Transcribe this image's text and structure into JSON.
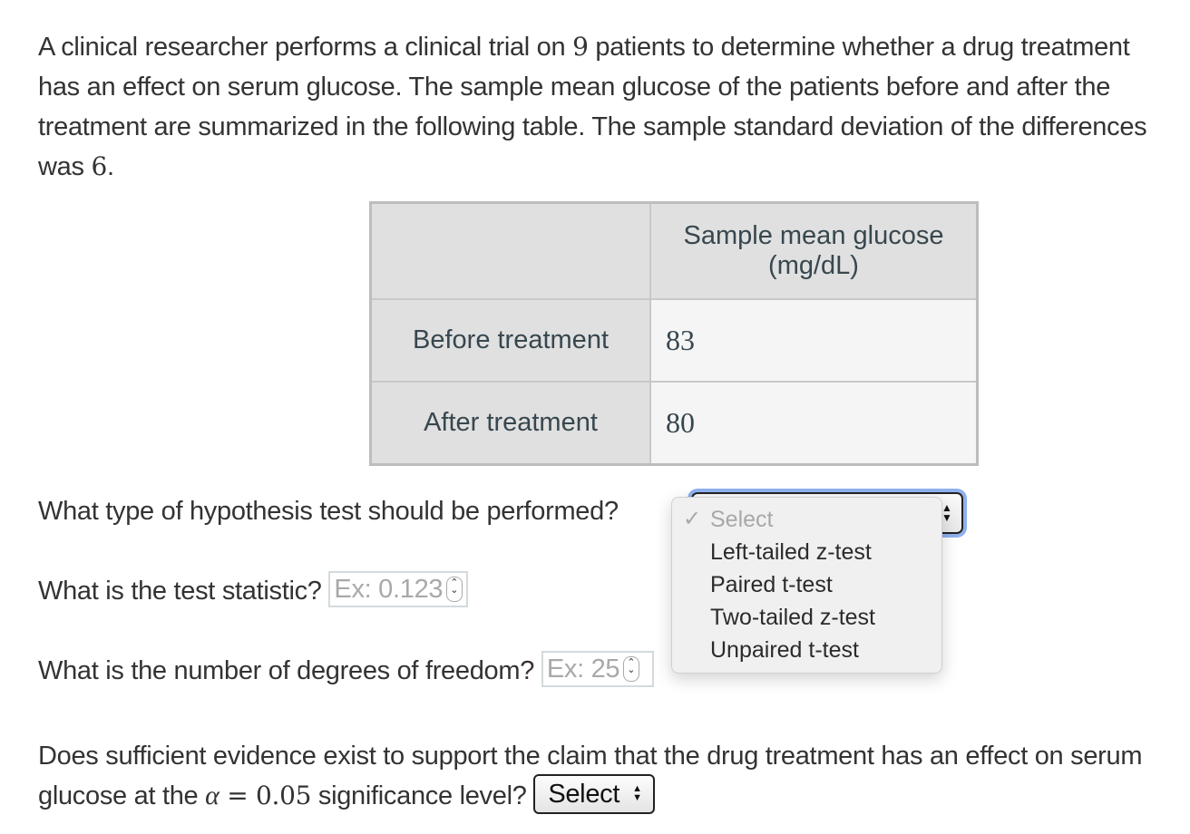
{
  "problem": {
    "intro_1": "A clinical researcher performs a clinical trial on ",
    "n_patients": "9",
    "intro_2": " patients to determine whether a drug treatment has an effect on serum glucose. The sample mean glucose of the patients before and after the treatment are summarized in the following table. The sample standard deviation of the differences was ",
    "sd_diff": "6",
    "intro_end": "."
  },
  "table": {
    "header": "Sample mean glucose (mg/dL)",
    "rows": [
      {
        "label": "Before treatment",
        "value": "83"
      },
      {
        "label": "After treatment",
        "value": "80"
      }
    ]
  },
  "questions": {
    "test_type": {
      "label": "What type of hypothesis test should be performed?",
      "selected": "Select",
      "options": [
        "Select",
        "Left-tailed z-test",
        "Paired t-test",
        "Two-tailed z-test",
        "Unpaired t-test"
      ]
    },
    "test_statistic": {
      "label": "What is the test statistic?",
      "placeholder": "Ex: 0.123"
    },
    "dof": {
      "label": "What is the number of degrees of freedom?",
      "placeholder": "Ex: 25"
    },
    "evidence": {
      "label_1": "Does sufficient evidence exist to support the claim that the drug treatment has an effect on serum glucose at the ",
      "alpha_symbol": "α",
      "equals": " = ",
      "alpha_value": "0.05",
      "label_2": " significance level?",
      "selected": "Select"
    }
  },
  "colors": {
    "focus_ring": "#8fb0ee",
    "table_header_bg": "#e0e0e0",
    "table_value_bg": "#f5f5f5"
  }
}
